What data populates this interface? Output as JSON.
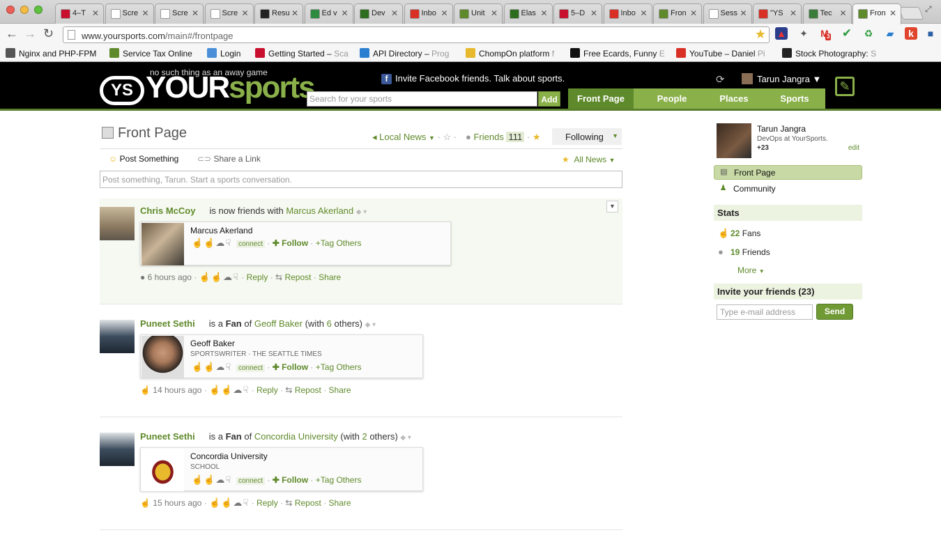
{
  "browser": {
    "tabs": [
      {
        "label": "4–T",
        "icon_color": "#c8102e"
      },
      {
        "label": "Scre",
        "icon_color": "#ffffff"
      },
      {
        "label": "Scre",
        "icon_color": "#ffffff"
      },
      {
        "label": "Scre",
        "icon_color": "#ffffff"
      },
      {
        "label": "Resu",
        "icon_color": "#222222"
      },
      {
        "label": "Ed v",
        "icon_color": "#2d8a3e"
      },
      {
        "label": "Dev",
        "icon_color": "#2d6e1e"
      },
      {
        "label": "Inbo",
        "icon_color": "#d93025"
      },
      {
        "label": "Unit",
        "icon_color": "#5f8a2b"
      },
      {
        "label": "Elas",
        "icon_color": "#2d6e1e"
      },
      {
        "label": "5–D",
        "icon_color": "#c8102e"
      },
      {
        "label": "Inbo",
        "icon_color": "#d93025"
      },
      {
        "label": "Fron",
        "icon_color": "#5f8a2b"
      },
      {
        "label": "Sess",
        "icon_color": "#ffffff"
      },
      {
        "label": "\"YS",
        "icon_color": "#d93025"
      },
      {
        "label": "Tec",
        "icon_color": "#3a7d3a"
      },
      {
        "label": "Fron",
        "icon_color": "#5f8a2b"
      }
    ],
    "url_host": "www.yoursports.com",
    "url_path": "/main#/frontpage",
    "gmail_badge": "3",
    "bookmarks": [
      {
        "label": "Nginx and PHP-FPM",
        "fade": ""
      },
      {
        "label": "Service Tax Online",
        "fade": ""
      },
      {
        "label": "Login",
        "fade": ""
      },
      {
        "label": "Getting Started – ",
        "fade": "Sca"
      },
      {
        "label": "API Directory – ",
        "fade": "Prog"
      },
      {
        "label": "ChompOn platform ",
        "fade": "f"
      },
      {
        "label": "Free Ecards, Funny ",
        "fade": "E"
      },
      {
        "label": "YouTube – Daniel ",
        "fade": "Pi"
      },
      {
        "label": "Stock Photography: ",
        "fade": "S"
      }
    ]
  },
  "site": {
    "tagline": "no such thing as an away game",
    "logo_ys": "YS",
    "logo_your": "YOUR",
    "logo_sports": "sports",
    "fb_invite": "Invite Facebook friends. Talk about sports.",
    "user_name": "Tarun Jangra",
    "search_placeholder": "Search for your sports",
    "add_label": "Add",
    "nav": [
      "Front Page",
      "People",
      "Places",
      "Sports"
    ],
    "accent": "#8ab04a"
  },
  "main": {
    "title": "Front Page",
    "local_news": "Local News",
    "friends_label": "Friends",
    "friends_count": "111",
    "following_label": "Following",
    "post_something": "Post Something",
    "share_link": "Share a Link",
    "all_news": "All News",
    "post_placeholder": "Post something, Tarun. Start a sports conversation."
  },
  "feed": [
    {
      "actor": "Chris McCoy",
      "verb": "is now friends with",
      "object": "Marcus Akerland",
      "extra_pre": "",
      "extra_num": "",
      "extra_post": "",
      "card_name": "Marcus Akerland",
      "card_sub": "",
      "time": "6 hours ago"
    },
    {
      "actor": "Puneet Sethi",
      "verb_pre": "is a",
      "verb_strong": "Fan",
      "verb_post": "of",
      "object": "Geoff Baker",
      "extra_pre": "(with",
      "extra_num": "6",
      "extra_post": "others)",
      "card_name": "Geoff Baker",
      "card_sub": "SPORTSWRITER · THE SEATTLE TIMES",
      "time": "14 hours ago"
    },
    {
      "actor": "Puneet Sethi",
      "verb_pre": "is a",
      "verb_strong": "Fan",
      "verb_post": "of",
      "object": "Concordia University",
      "extra_pre": "(with",
      "extra_num": "2",
      "extra_post": "others)",
      "card_name": "Concordia University",
      "card_sub": "SCHOOL",
      "time": "15 hours ago"
    }
  ],
  "card_actions": {
    "connect": "connect",
    "follow": "Follow",
    "tag_others": "+Tag Others"
  },
  "meta_actions": {
    "reply": "Reply",
    "repost": "Repost",
    "share": "Share"
  },
  "sidebar": {
    "profile_name": "Tarun Jangra",
    "profile_role": "DevOps at YourSports.",
    "profile_points": "+23",
    "edit": "edit",
    "items": [
      "Front Page",
      "Community"
    ],
    "stats_head": "Stats",
    "fans_count": "22",
    "fans_label": "Fans",
    "friends_count": "19",
    "friends_label": "Friends",
    "more": "More",
    "invite_head": "Invite your friends (23)",
    "email_placeholder": "Type e-mail address",
    "send": "Send"
  }
}
